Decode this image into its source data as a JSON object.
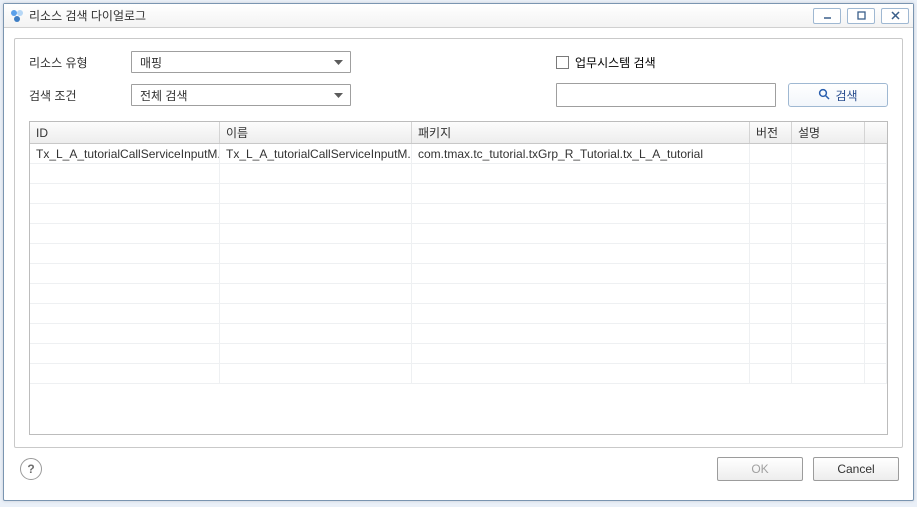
{
  "window": {
    "title": "리소스 검색 다이얼로그"
  },
  "form": {
    "resource_type_label": "리소스 유형",
    "resource_type_value": "매핑",
    "search_condition_label": "검색 조건",
    "search_condition_value": "전체 검색",
    "biz_system_checkbox_label": "업무시스템 검색",
    "search_input_value": "",
    "search_button_label": "검색"
  },
  "table": {
    "headers": {
      "id": "ID",
      "name": "이름",
      "pkg": "패키지",
      "ver": "버전",
      "desc": "설명"
    },
    "rows": [
      {
        "id": "Tx_L_A_tutorialCallServiceInputM...",
        "name": "Tx_L_A_tutorialCallServiceInputM...",
        "pkg": "com.tmax.tc_tutorial.txGrp_R_Tutorial.tx_L_A_tutorial",
        "ver": "",
        "desc": ""
      }
    ]
  },
  "footer": {
    "help_glyph": "?",
    "ok_label": "OK",
    "cancel_label": "Cancel"
  }
}
